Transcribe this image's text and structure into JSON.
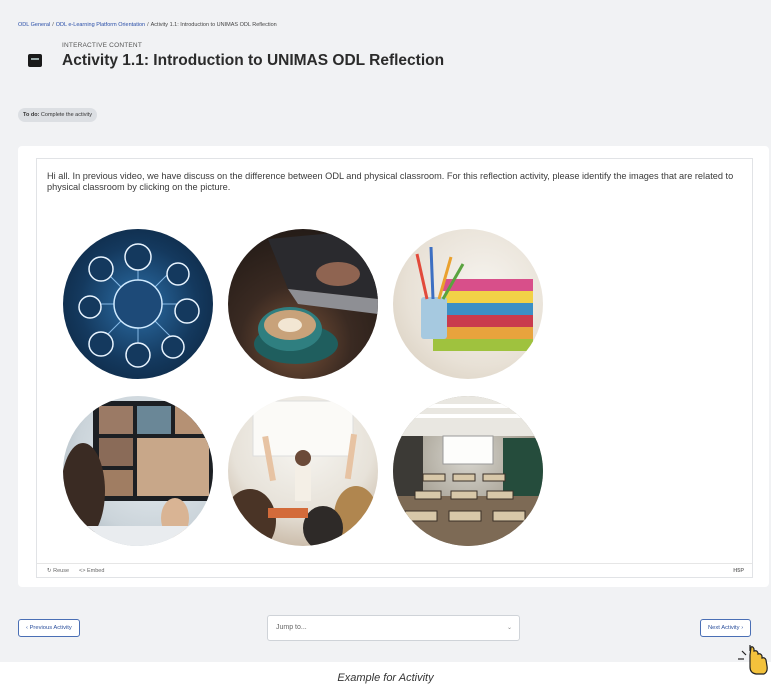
{
  "breadcrumb": {
    "course": "ODL General",
    "section": "ODL e-Learning Platform Orientation",
    "current": "Activity 1.1: Introduction to UNIMAS ODL Reflection"
  },
  "header": {
    "type_label": "INTERACTIVE CONTENT",
    "title": "Activity 1.1: Introduction to UNIMAS ODL Reflection"
  },
  "todo": {
    "label": "To do:",
    "text": "Complete the activity"
  },
  "activity": {
    "intro": "Hi all. In previous video, we have discuss on the difference between ODL and physical classroom. For this reflection activity, please identify the images that are related to physical classroom by clicking on the picture.",
    "images": [
      {
        "name": "network-tech-image"
      },
      {
        "name": "coffee-laptop-image"
      },
      {
        "name": "books-pencils-image"
      },
      {
        "name": "video-call-image"
      },
      {
        "name": "classroom-hands-image"
      },
      {
        "name": "empty-classroom-image"
      }
    ],
    "footer": {
      "reuse": "Reuse",
      "embed": "Embed",
      "brand": "H5P"
    }
  },
  "navigation": {
    "previous": "Previous Activity",
    "jump_placeholder": "Jump to...",
    "next": "Next Activity"
  },
  "caption": "Example for Activity",
  "colors": {
    "link": "#2a4fa8",
    "button_border": "#4a6fb5",
    "page_bg": "#f1f2f4"
  }
}
